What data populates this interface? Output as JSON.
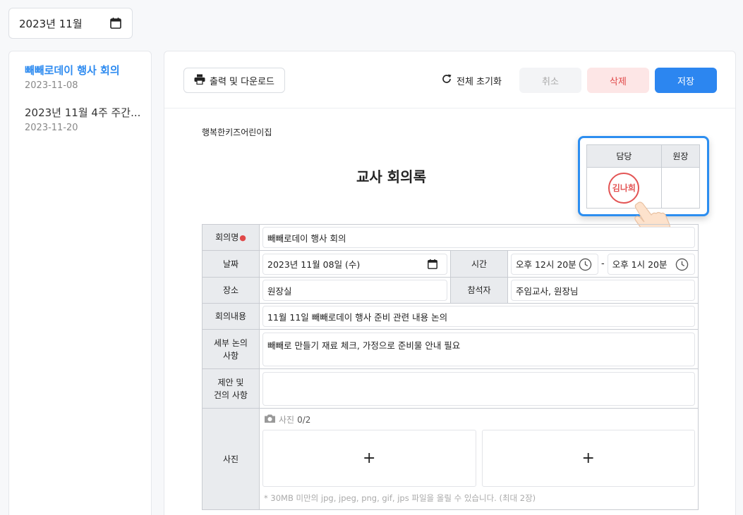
{
  "month_picker": {
    "value": "2023년 11월"
  },
  "sidebar": {
    "items": [
      {
        "title": "빼빼로데이 행사 회의",
        "date": "2023-11-08"
      },
      {
        "title": "2023년 11월 4주 주간...",
        "date": "2023-11-20"
      }
    ]
  },
  "toolbar": {
    "print_label": "출력 및 다운로드",
    "reset_label": "전체 초기화",
    "cancel_label": "취소",
    "delete_label": "삭제",
    "save_label": "저장"
  },
  "document": {
    "org_name": "행복한키즈어린이집",
    "title": "교사 회의록"
  },
  "approval": {
    "col1": "담당",
    "col2": "원장",
    "stamp_name": "김나희"
  },
  "form": {
    "name_label": "회의명",
    "name_value": "빼빼로데이 행사 회의",
    "date_label": "날짜",
    "date_value": "2023년 11월 08일 (수)",
    "time_label": "시간",
    "time_start": "오후 12시 20분",
    "time_sep": "-",
    "time_end": "오후 1시 20분",
    "place_label": "장소",
    "place_value": "원장실",
    "attendee_label": "참석자",
    "attendee_value": "주임교사, 원장님",
    "content_label": "회의내용",
    "content_value": "11월 11일 빼빼로데이 행사 준비 관련 내용 논의",
    "detail_label_1": "세부 논의",
    "detail_label_2": "사항",
    "detail_value": "빼빼로 만들기 재료 체크, 가정으로 준비물 안내 필요",
    "proposal_label_1": "제안 및",
    "proposal_label_2": "건의 사항",
    "proposal_value": "",
    "photo_label": "사진",
    "photo_caption": "사진",
    "photo_count": "0/2",
    "photo_add": "+",
    "photo_note": "* 30MB 미만의 jpg, jpeg, png, gif, jps 파일을 올릴 수 있습니다. (최대 2장)"
  }
}
